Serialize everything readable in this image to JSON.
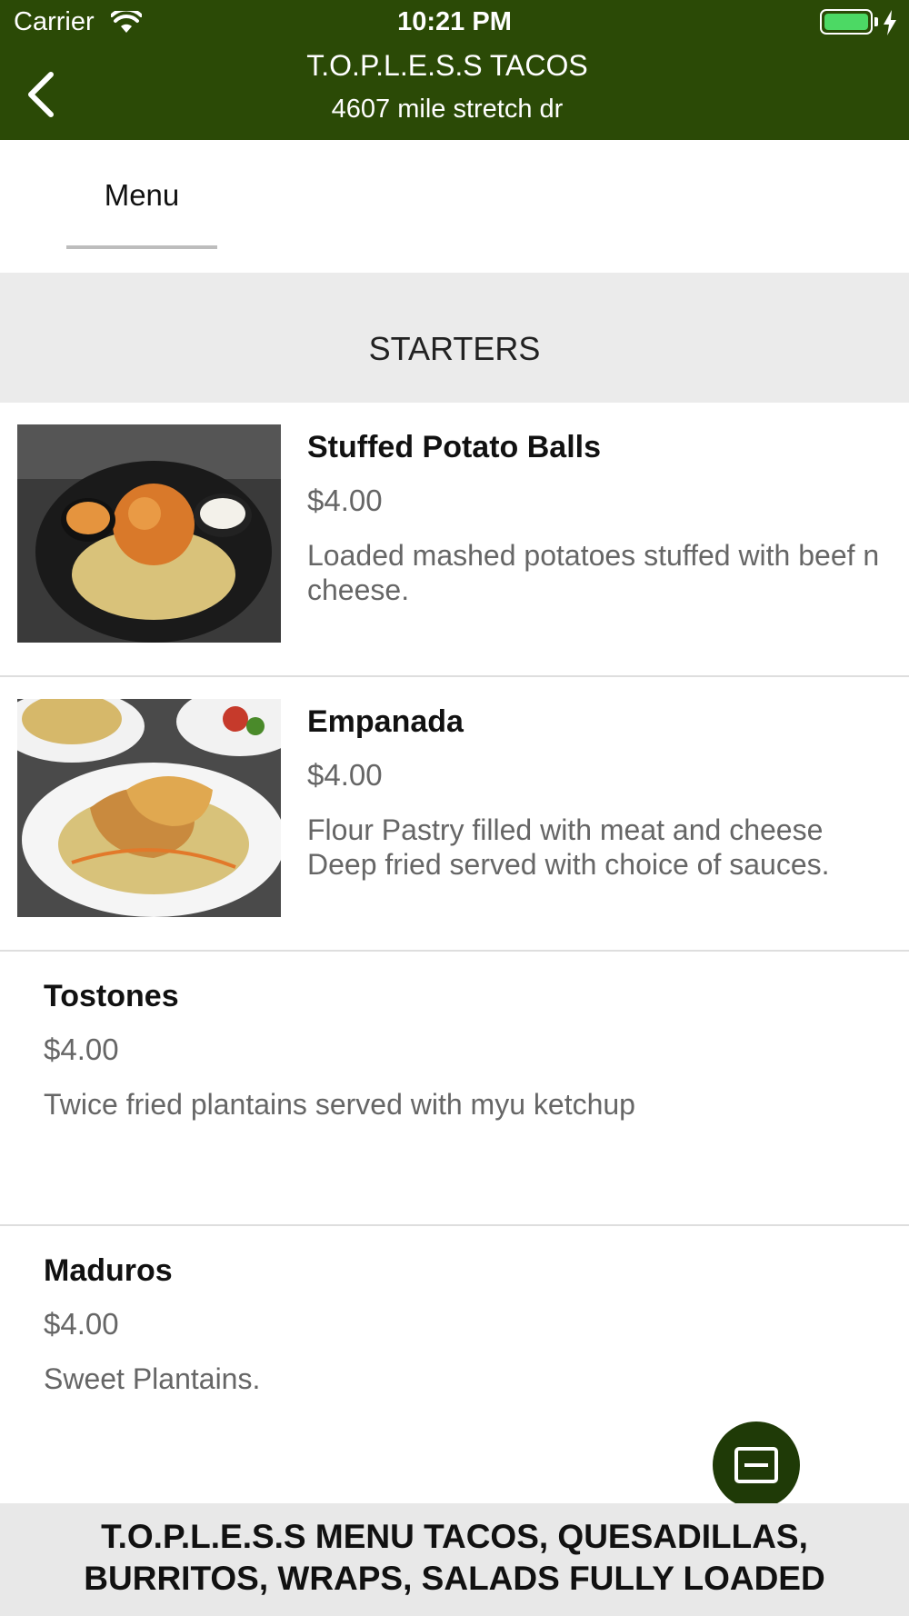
{
  "status_bar": {
    "carrier": "Carrier",
    "time": "10:21 PM",
    "battery_color": "#4cd964"
  },
  "header": {
    "title": "T.O.P.L.E.S.S TACOS",
    "subtitle": "4607 mile stretch dr",
    "background_color": "#2b4a06",
    "back_icon": "chevron-left-icon"
  },
  "tabs": [
    {
      "label": "Menu",
      "selected": true
    }
  ],
  "section": {
    "title": "STARTERS"
  },
  "items": [
    {
      "name": "Stuffed Potato Balls",
      "price": "$4.00",
      "description": "Loaded mashed potatoes stuffed with beef n cheese.",
      "has_image": true
    },
    {
      "name": "Empanada",
      "price": "$4.00",
      "description": "Flour Pastry filled with meat and cheese Deep fried served with choice of sauces.",
      "has_image": true
    },
    {
      "name": "Tostones",
      "price": "$4.00",
      "description": "Twice fried plantains served with myu ketchup",
      "has_image": false
    },
    {
      "name": "Maduros",
      "price": "$4.00",
      "description": "Sweet Plantains.",
      "has_image": false
    }
  ],
  "fab": {
    "icon": "cart-icon",
    "color": "#1f3a07"
  },
  "footer": {
    "text": "T.O.P.L.E.S.S MENU TACOS, QUESADILLAS, BURRITOS, WRAPS, SALADS FULLY LOADED"
  }
}
